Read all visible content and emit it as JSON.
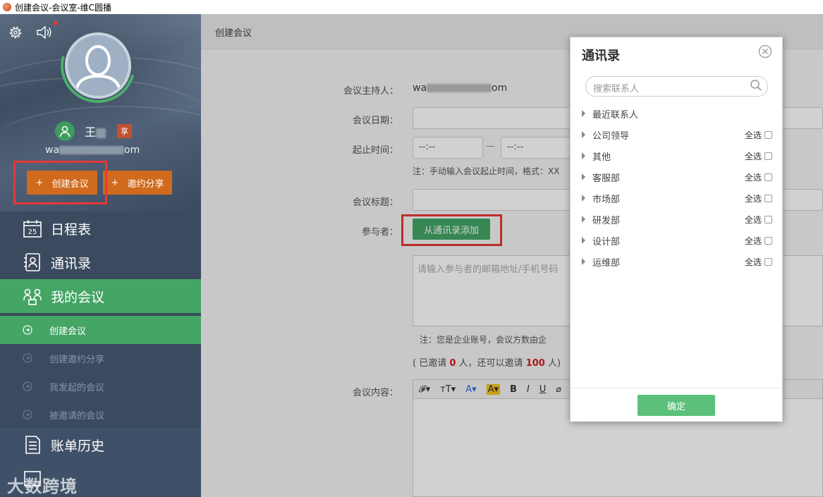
{
  "window": {
    "title": "创建会议-会议室-维C圆播"
  },
  "sidebar": {
    "user": {
      "name": "王",
      "badge": "享",
      "email_prefix": "wa",
      "email_suffix": "om"
    },
    "buttons": {
      "create_meeting": "创建会议",
      "invite_share": "邀约分享",
      "plus": "+"
    },
    "nav": [
      {
        "label": "日程表",
        "icon": "calendar-icon"
      },
      {
        "label": "通讯录",
        "icon": "contacts-icon"
      },
      {
        "label": "我的会议",
        "icon": "meeting-icon"
      }
    ],
    "sub_nav": [
      {
        "label": "创建会议"
      },
      {
        "label": "创建邀约分享"
      },
      {
        "label": "我发起的会议"
      },
      {
        "label": "被邀请的会议"
      }
    ],
    "nav_bottom": [
      {
        "label": "账单历史",
        "icon": "bill-icon"
      }
    ],
    "watermark": "大数跨境"
  },
  "main": {
    "header": "创建会议",
    "form": {
      "host_label": "会议主持人：",
      "host_prefix": "wa",
      "host_suffix": "om",
      "date_label": "会议日期：",
      "time_label": "起止时间：",
      "time_start": "--:--",
      "time_dash": "—",
      "time_end": "--:--",
      "time_note": "注：手动输入会议起止时间，格式：XX",
      "title_label": "会议标题：",
      "participants_label": "参与者：",
      "add_from_contacts": "从通讯录添加",
      "participants_placeholder": "请输入参与者的邮箱地址/手机号码",
      "enterprise_note": "注：您是企业账号，会议方数由企",
      "invite_count_prefix": "( 已邀请",
      "invited": "0",
      "invite_count_mid": "人，还可以邀请",
      "remaining": "100",
      "invite_count_suffix": "人)",
      "content_label": "会议内容：",
      "editor_tools": [
        "𝓕▾",
        "ᴛT▾",
        "A▾",
        "A▾",
        "B",
        "I",
        "U",
        "⌀"
      ]
    }
  },
  "modal": {
    "title": "通讯录",
    "search_placeholder": "搜索联系人",
    "select_all": "全选",
    "groups": [
      {
        "name": "最近联系人",
        "has_select": false
      },
      {
        "name": "公司领导",
        "has_select": true
      },
      {
        "name": "其他",
        "has_select": true
      },
      {
        "name": "客服部",
        "has_select": true
      },
      {
        "name": "市场部",
        "has_select": true
      },
      {
        "name": "研发部",
        "has_select": true
      },
      {
        "name": "设计部",
        "has_select": true
      },
      {
        "name": "运维部",
        "has_select": true
      }
    ],
    "confirm": "确定"
  }
}
